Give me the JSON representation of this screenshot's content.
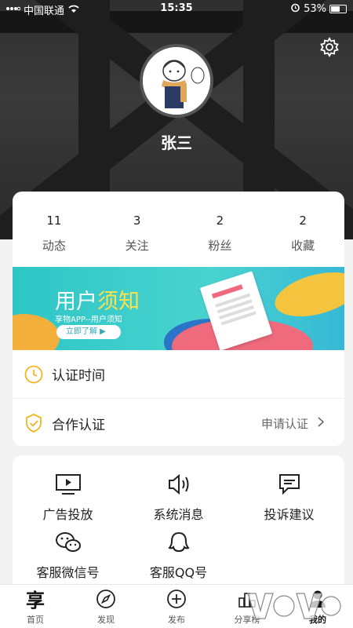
{
  "status_bar": {
    "carrier": "中国联通",
    "time": "15:35",
    "battery": "53%"
  },
  "profile": {
    "name": "张三"
  },
  "stats": [
    {
      "value": "11",
      "label": "动态"
    },
    {
      "value": "3",
      "label": "关注"
    },
    {
      "value": "2",
      "label": "粉丝"
    },
    {
      "value": "2",
      "label": "收藏"
    }
  ],
  "banner": {
    "title_main": "用户",
    "title_accent": "须知",
    "subtitle": "享物APP--用户须知",
    "button": "立即了解"
  },
  "rows": {
    "auth_time": "认证时间",
    "coop_auth": "合作认证",
    "coop_action": "申请认证"
  },
  "services": [
    {
      "label": "广告投放",
      "icon": "video-icon"
    },
    {
      "label": "系统消息",
      "icon": "speaker-icon"
    },
    {
      "label": "投诉建议",
      "icon": "message-icon"
    },
    {
      "label": "客服微信号",
      "icon": "wechat-icon"
    },
    {
      "label": "客服QQ号",
      "icon": "qq-icon"
    }
  ],
  "tabs": [
    {
      "label": "首页",
      "glyph": "享"
    },
    {
      "label": "发现"
    },
    {
      "label": "发布"
    },
    {
      "label": "分享榜"
    },
    {
      "label": "我的"
    }
  ],
  "colors": {
    "accent_yellow": "#f2b61d",
    "banner_teal": "#2ec6c6"
  }
}
